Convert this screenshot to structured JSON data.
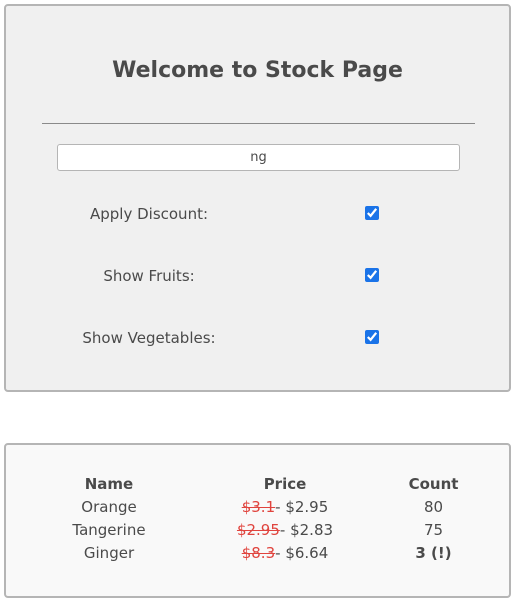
{
  "page": {
    "title": "Welcome to Stock Page"
  },
  "search": {
    "value": "ng",
    "placeholder": ""
  },
  "options": [
    {
      "label": "Apply Discount:",
      "checked": true
    },
    {
      "label": "Show Fruits:",
      "checked": true
    },
    {
      "label": "Show Vegetables:",
      "checked": true
    }
  ],
  "table": {
    "headers": {
      "name": "Name",
      "price": "Price",
      "count": "Count"
    },
    "rows": [
      {
        "name": "Orange",
        "old_price": "$3.1",
        "separator": "- ",
        "new_price": "$2.95",
        "count": "80"
      },
      {
        "name": "Tangerine",
        "old_price": "$2.95",
        "separator": "- ",
        "new_price": "$2.83",
        "count": "75"
      },
      {
        "name": "Ginger",
        "old_price": "$8.3",
        "separator": "- ",
        "new_price": "$6.64",
        "count": "3 (!)"
      }
    ]
  },
  "colors": {
    "old_price": "#e0443e",
    "low_stock_warning": "#f5a300",
    "checkbox_accent": "#1a73e8"
  }
}
